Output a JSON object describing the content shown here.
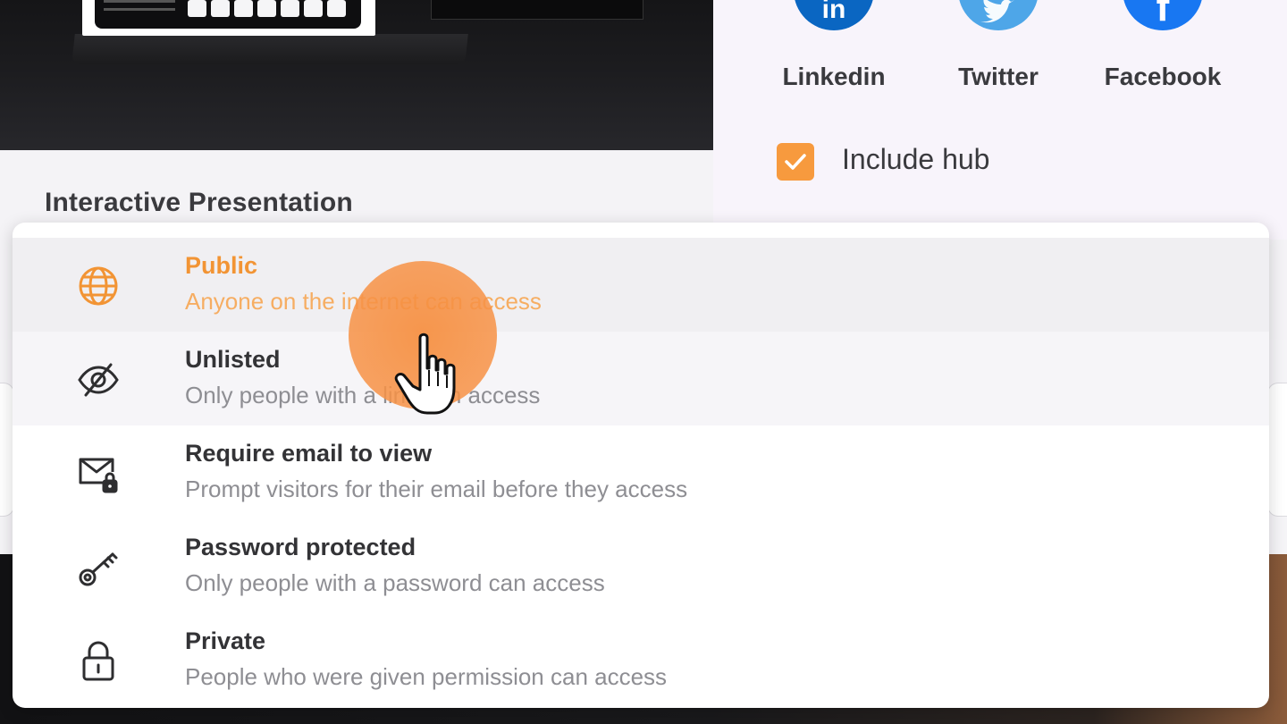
{
  "presentation": {
    "title": "Interactive Presentation"
  },
  "share": {
    "networks": [
      {
        "label": "Linkedin",
        "icon": "linkedin-icon",
        "color": "#0a66c2",
        "glyph": "in"
      },
      {
        "label": "Twitter",
        "icon": "twitter-icon",
        "color": "#4ea6e8",
        "glyph": ""
      },
      {
        "label": "Facebook",
        "icon": "facebook-icon",
        "color": "#1877f2",
        "glyph": "f"
      }
    ],
    "include_hub": {
      "label": "Include hub",
      "checked": true,
      "color": "#f79a3e"
    }
  },
  "visibility_menu": {
    "selected": "Public",
    "options": [
      {
        "title": "Public",
        "description": "Anyone on the internet can access",
        "icon": "globe-icon"
      },
      {
        "title": "Unlisted",
        "description": "Only people with a link can access",
        "icon": "eye-slash-icon"
      },
      {
        "title": "Require email to view",
        "description": "Prompt visitors for their email before they access",
        "icon": "email-lock-icon"
      },
      {
        "title": "Password protected",
        "description": "Only people with a password can access",
        "icon": "key-icon"
      },
      {
        "title": "Private",
        "description": "People who were given permission can access",
        "icon": "lock-icon"
      }
    ]
  },
  "colors": {
    "accent": "#f29434",
    "accent_light": "#f6ad62",
    "text_dark": "#333336",
    "text_muted": "#8e8e93"
  }
}
